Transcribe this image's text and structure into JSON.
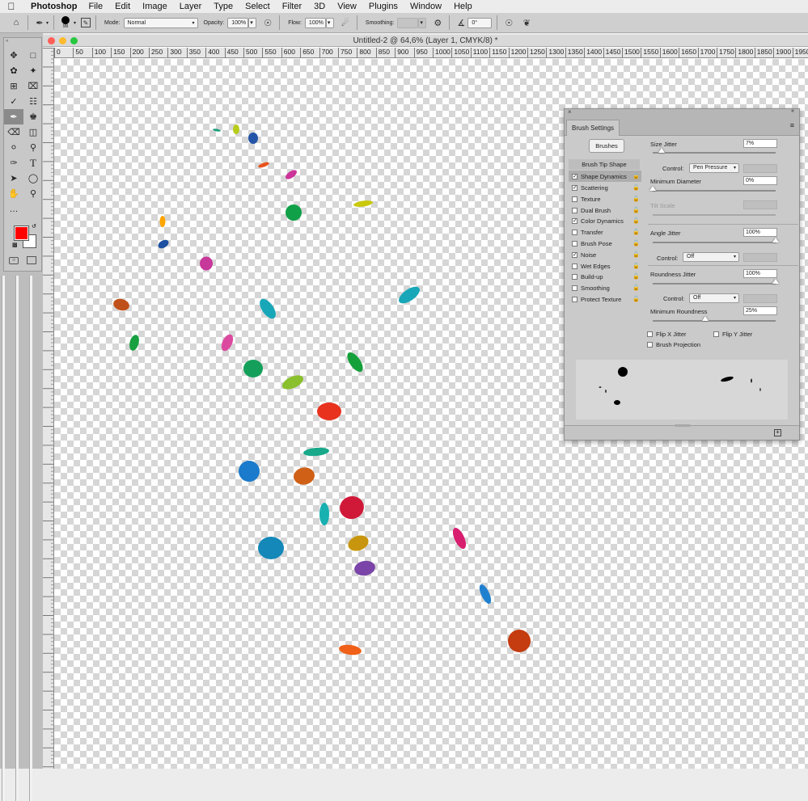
{
  "menubar": {
    "app": "Photoshop",
    "items": [
      "File",
      "Edit",
      "Image",
      "Layer",
      "Type",
      "Select",
      "Filter",
      "3D",
      "View",
      "Plugins",
      "Window",
      "Help"
    ]
  },
  "options": {
    "brush_size": "98",
    "mode_label": "Mode:",
    "mode_value": "Normal",
    "opacity_label": "Opacity:",
    "opacity_value": "100%",
    "flow_label": "Flow:",
    "flow_value": "100%",
    "smoothing_label": "Smoothing:",
    "smoothing_value": "",
    "angle_value": "0°"
  },
  "document": {
    "title": "Untitled-2 @ 64,6% (Layer 1, CMYK/8) *",
    "ruler_labels": [
      "0",
      "50",
      "100",
      "150",
      "200",
      "250",
      "300",
      "350",
      "400",
      "450",
      "500",
      "550",
      "600",
      "650",
      "700",
      "750",
      "800",
      "850",
      "900",
      "950",
      "1000",
      "1050",
      "1100",
      "1150",
      "1200",
      "1250",
      "1300",
      "1350",
      "1400",
      "1450",
      "1500",
      "1550",
      "1600",
      "1650",
      "1700",
      "1750",
      "1800",
      "1850",
      "1900",
      "1950"
    ]
  },
  "colors": {
    "foreground": "#ff0000",
    "background": "#ffffff"
  },
  "brush_panel": {
    "tab": "Brush Settings",
    "brushes_button": "Brushes",
    "tip_shape": "Brush Tip Shape",
    "items": [
      {
        "label": "Shape Dynamics",
        "checked": true
      },
      {
        "label": "Scattering",
        "checked": true
      },
      {
        "label": "Texture",
        "checked": false
      },
      {
        "label": "Dual Brush",
        "checked": false
      },
      {
        "label": "Color Dynamics",
        "checked": true
      },
      {
        "label": "Transfer",
        "checked": false
      },
      {
        "label": "Brush Pose",
        "checked": false
      },
      {
        "label": "Noise",
        "checked": true
      },
      {
        "label": "Wet Edges",
        "checked": false
      },
      {
        "label": "Build-up",
        "checked": false
      },
      {
        "label": "Smoothing",
        "checked": false
      },
      {
        "label": "Protect Texture",
        "checked": false
      }
    ],
    "size_jitter_label": "Size Jitter",
    "size_jitter_value": "7%",
    "size_jitter_level": 0.07,
    "control_label": "Control:",
    "size_control": "Pen Pressure",
    "min_diameter_label": "Minimum Diameter",
    "min_diameter_value": "0%",
    "tilt_scale_label": "Tilt Scale",
    "angle_jitter_label": "Angle Jitter",
    "angle_jitter_value": "100%",
    "angle_control": "Off",
    "roundness_jitter_label": "Roundness Jitter",
    "roundness_jitter_value": "100%",
    "roundness_control": "Off",
    "min_roundness_label": "Minimum Roundness",
    "min_roundness_value": "25%",
    "flip_x_label": "Flip X Jitter",
    "flip_y_label": "Flip Y Jitter",
    "projection_label": "Brush Projection"
  }
}
